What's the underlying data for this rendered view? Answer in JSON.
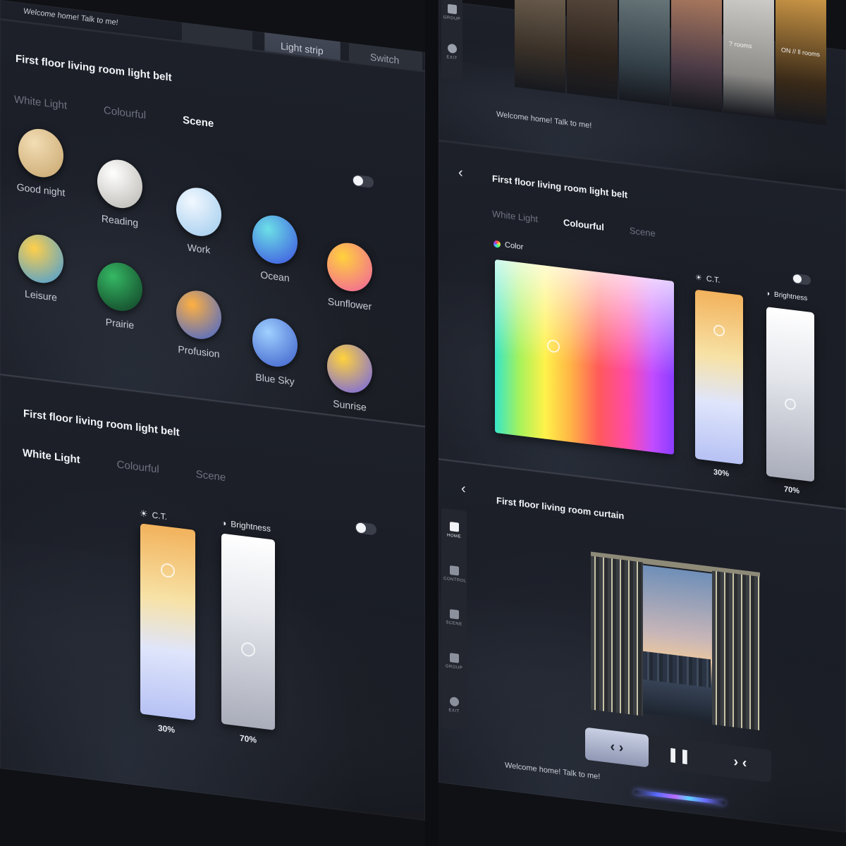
{
  "top_left_strip": {
    "welcome": "Welcome home! Talk to me!",
    "devices": [
      {
        "label": "Light strip",
        "icon": "light-strip-icon"
      },
      {
        "label": "Switch",
        "icon": "switch-icon"
      }
    ]
  },
  "scene_panel": {
    "title": "First floor living room light belt",
    "tabs": [
      "White Light",
      "Colourful",
      "Scene"
    ],
    "active_tab": "Scene",
    "toggle_on": false,
    "scenes": [
      {
        "label": "Good night",
        "colors": [
          "#f2ddb4",
          "#c7a56d"
        ]
      },
      {
        "label": "Reading",
        "colors": [
          "#ffffff",
          "#b5b3ad"
        ]
      },
      {
        "label": "Work",
        "colors": [
          "#f2f8ff",
          "#9cc9ec"
        ]
      },
      {
        "label": "Ocean",
        "colors": [
          "#6ce0e6",
          "#3b4de0"
        ]
      },
      {
        "label": "Sunflower",
        "colors": [
          "#ffd23c",
          "#f05ca2"
        ]
      },
      {
        "label": "Leisure",
        "colors": [
          "#ffcf4a",
          "#3c9be0"
        ]
      },
      {
        "label": "Prairie",
        "colors": [
          "#35b864",
          "#0f3a22"
        ]
      },
      {
        "label": "Profusion",
        "colors": [
          "#ffb040",
          "#3a62d8"
        ]
      },
      {
        "label": "Blue Sky",
        "colors": [
          "#9fd0ff",
          "#3a5cc8"
        ]
      },
      {
        "label": "Sunrise",
        "colors": [
          "#ffd23c",
          "#6b5ef0"
        ]
      }
    ]
  },
  "white_light_panel": {
    "title": "First floor living room light belt",
    "tabs": [
      "White Light",
      "Colourful",
      "Scene"
    ],
    "active_tab": "White Light",
    "toggle_on": false,
    "ct_label": "C.T.",
    "brightness_label": "Brightness",
    "ct_percent": "30%",
    "brightness_percent": "70%"
  },
  "gallery_panel": {
    "nav": [
      {
        "label": "GROUP",
        "icon": "group-icon"
      },
      {
        "label": "EXIT",
        "icon": "exit-icon"
      }
    ],
    "tiles": [
      {
        "caption": "",
        "colors": [
          "#8a7a66",
          "#3a3128"
        ]
      },
      {
        "caption": "",
        "colors": [
          "#6c5a4a",
          "#2b221c"
        ]
      },
      {
        "caption": "",
        "colors": [
          "#7b8a8c",
          "#35424a"
        ]
      },
      {
        "caption": "",
        "colors": [
          "#c48a64",
          "#4a3a46"
        ]
      },
      {
        "caption": "? rooms",
        "colors": [
          "#d9d7d2",
          "#8c8b88"
        ]
      },
      {
        "caption": "ON // ll rooms",
        "colors": [
          "#d8a04a",
          "#3a2a18"
        ]
      }
    ],
    "welcome": "Welcome home! Talk to me!"
  },
  "colourful_panel": {
    "title": "First floor living room light belt",
    "tabs": [
      "White Light",
      "Colourful",
      "Scene"
    ],
    "active_tab": "Colourful",
    "color_label": "Color",
    "toggle_on": false,
    "ct_label": "C.T.",
    "brightness_label": "Brightness",
    "ct_percent": "30%",
    "brightness_percent": "70%"
  },
  "curtain_panel": {
    "title": "First floor living room curtain",
    "nav": [
      {
        "label": "HOME",
        "icon": "home-icon"
      },
      {
        "label": "CONTROL",
        "icon": "control-icon"
      },
      {
        "label": "SCENE",
        "icon": "scene-icon"
      },
      {
        "label": "GROUP",
        "icon": "group-icon"
      },
      {
        "label": "EXIT",
        "icon": "exit-icon"
      }
    ],
    "controls": [
      "open",
      "pause",
      "close"
    ],
    "active_control": "open",
    "welcome": "Welcome home! Talk to me!"
  }
}
